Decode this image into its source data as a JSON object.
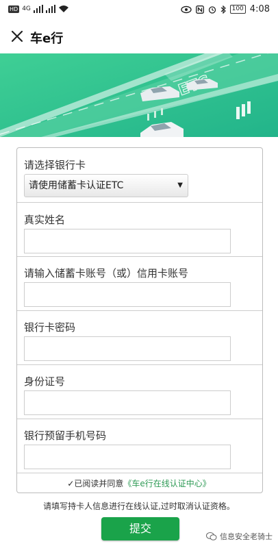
{
  "status_bar": {
    "hd": "HD",
    "network": "4G",
    "battery": "100",
    "time": "4:08"
  },
  "header": {
    "title": "车e行"
  },
  "banner": {
    "sign_text": "ETC"
  },
  "form": {
    "bank_card": {
      "label": "请选择银行卡",
      "selected": "请使用储蓄卡认证ETC"
    },
    "real_name": {
      "label": "真实姓名",
      "value": ""
    },
    "card_number": {
      "label": "请输入储蓄卡账号（或）信用卡账号",
      "value": ""
    },
    "card_password": {
      "label": "银行卡密码",
      "value": ""
    },
    "id_number": {
      "label": "身份证号",
      "value": ""
    },
    "phone": {
      "label": "银行预留手机号码",
      "value": ""
    }
  },
  "agreement": {
    "check": "✓",
    "prefix": "已阅读并同意",
    "link": "《车e行在线认证中心》"
  },
  "notice": "请填写持卡人信息进行在线认证,过时取消认证资格。",
  "submit_label": "提交",
  "watermark": "信息安全老骑士",
  "colors": {
    "banner": "#2fc08f",
    "submit": "#1aa34a",
    "link": "#2e9a55"
  }
}
